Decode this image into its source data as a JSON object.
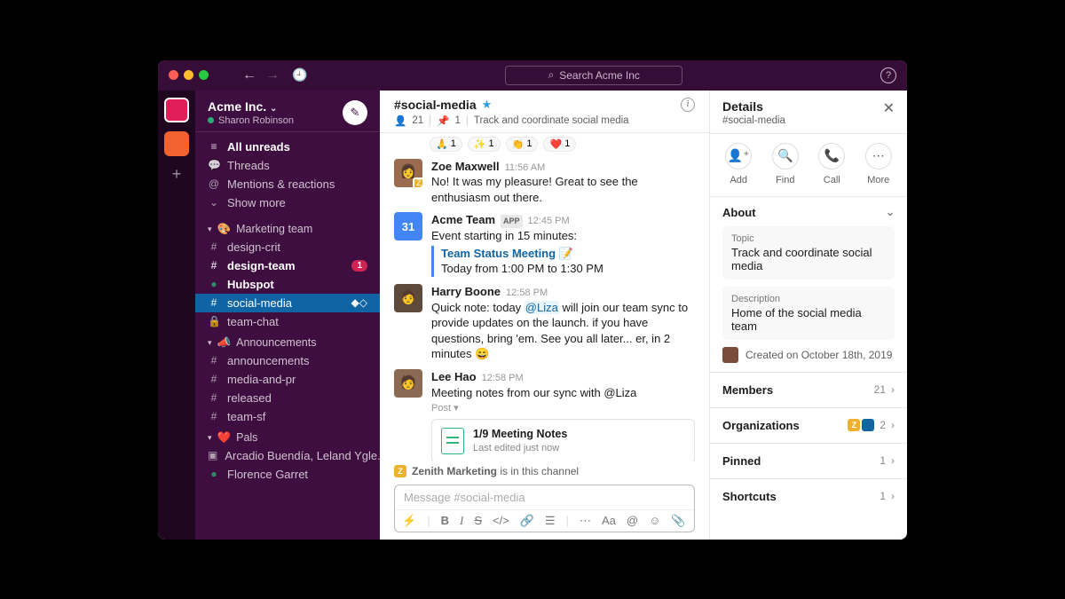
{
  "titlebar": {
    "search_placeholder": "Search Acme Inc"
  },
  "workspace": {
    "name": "Acme Inc.",
    "user": "Sharon Robinson"
  },
  "nav": {
    "all_unreads": "All unreads",
    "threads": "Threads",
    "mentions": "Mentions & reactions",
    "show_more": "Show more"
  },
  "groups": {
    "marketing": {
      "label": "Marketing team",
      "channels": [
        {
          "name": "design-crit",
          "prefix": "#"
        },
        {
          "name": "design-team",
          "prefix": "#",
          "badge": "1",
          "bold": true
        },
        {
          "name": "Hubspot",
          "prefix": "●",
          "bold": true
        },
        {
          "name": "social-media",
          "prefix": "#",
          "active": true
        },
        {
          "name": "team-chat",
          "prefix": "🔒"
        }
      ]
    },
    "announcements": {
      "label": "Announcements",
      "channels": [
        {
          "name": "announcements",
          "prefix": "#"
        },
        {
          "name": "media-and-pr",
          "prefix": "#"
        },
        {
          "name": "released",
          "prefix": "#"
        },
        {
          "name": "team-sf",
          "prefix": "#"
        }
      ]
    },
    "pals": {
      "label": "Pals",
      "emoji": "❤️",
      "dms": [
        {
          "name": "Arcadio Buendía, Leland Ygle..."
        },
        {
          "name": "Florence Garret"
        }
      ]
    }
  },
  "channel": {
    "name": "#social-media",
    "member_count": "21",
    "pin_count": "1",
    "topic_short": "Track and coordinate social media"
  },
  "reactions": [
    {
      "emoji": "🙏",
      "count": "1"
    },
    {
      "emoji": "✨",
      "count": "1"
    },
    {
      "emoji": "👏",
      "count": "1"
    },
    {
      "emoji": "❤️",
      "count": "1"
    }
  ],
  "messages": {
    "zoe": {
      "author": "Zoe Maxwell",
      "time": "11:56 AM",
      "body": "No! It was my pleasure! Great to see the enthusiasm out there."
    },
    "acme": {
      "author": "Acme Team",
      "time": "12:45 PM",
      "line1": "Event starting in 15 minutes:",
      "event_title": "Team Status Meeting",
      "event_time": "Today from 1:00 PM to 1:30 PM",
      "cal_day": "31"
    },
    "harry": {
      "author": "Harry Boone",
      "time": "12:58 PM",
      "body_pre": "Quick note: today ",
      "mention": "@Liza",
      "body_post": " will join our team sync to provide updates on the launch. if you have questions, bring 'em. See you all later... er, in 2 minutes 😄"
    },
    "lee": {
      "author": "Lee Hao",
      "time": "12:58 PM",
      "body": "Meeting notes from our sync with @Liza",
      "post_label": "Post ▾",
      "attachment_title": "1/9 Meeting Notes",
      "attachment_sub": "Last edited just now"
    }
  },
  "presence_line": {
    "name": "Zenith Marketing",
    "suffix": "is in this channel"
  },
  "composer": {
    "placeholder": "Message #social-media"
  },
  "details": {
    "title": "Details",
    "subtitle": "#social-media",
    "actions": {
      "add": "Add",
      "find": "Find",
      "call": "Call",
      "more": "More"
    },
    "about": {
      "label": "About",
      "topic_label": "Topic",
      "topic": "Track and coordinate social media",
      "desc_label": "Description",
      "desc": "Home of the social media team",
      "created": "Created on October 18th, 2019"
    },
    "rows": {
      "members": {
        "label": "Members",
        "value": "21"
      },
      "organizations": {
        "label": "Organizations",
        "value": "2"
      },
      "pinned": {
        "label": "Pinned",
        "value": "1"
      },
      "shortcuts": {
        "label": "Shortcuts",
        "value": "1"
      }
    }
  }
}
